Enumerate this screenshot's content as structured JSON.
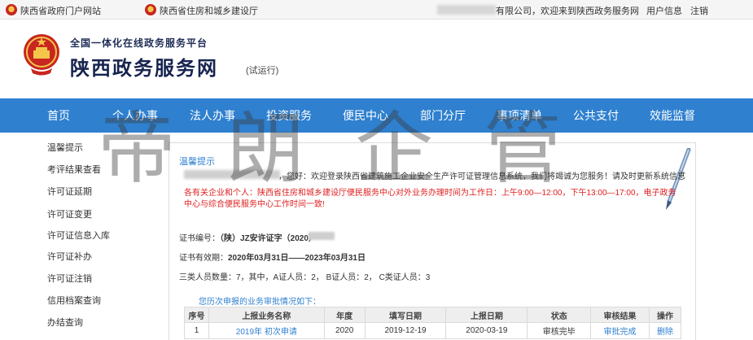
{
  "topbar": {
    "gov_portal": "陕西省政府门户网站",
    "housing_dept": "陕西省住房和城乡建设厅",
    "welcome": "有限公司，欢迎来到陕西政务服务网",
    "user_info": "用户信息",
    "logout": "注销"
  },
  "header": {
    "slogan": "全国一体化在线政务服务平台",
    "site_name": "陕西政务服务网",
    "trial": "(试运行)"
  },
  "nav": [
    "首页",
    "个人办事",
    "法人办事",
    "投资服务",
    "便民中心",
    "部门分厅",
    "事项清单",
    "公共支付",
    "效能监督"
  ],
  "watermark": "帝朗企管",
  "sidebar": [
    "温馨提示",
    "考评结果查看",
    "许可证延期",
    "许可证变更",
    "许可证信息入库",
    "许可证补办",
    "许可证注销",
    "信用档案查询",
    "办结查询"
  ],
  "panel": {
    "title": "温馨提示",
    "welcome": "，您好：欢迎登录陕西省建筑施工企业安全生产许可证管理信息系统，我们将竭诚为您服务！请及时更新系统信息",
    "notice": "各有关企业和个人：陕西省住房和城乡建设厅便民服务中心对外业务办理时间为工作日：上午9:00—12:00，下午13:00—17:00，电子政务中心与综合便民服务中心工作时间一致!",
    "cert_label": "证书编号：",
    "cert_value": "（陕）JZ安许证字（2020）",
    "valid_label": "证书有效期：",
    "valid_value": "2020年03月31日——2023年03月31日",
    "staff": "三类人员数量：7，其中，A证人员：2， B证人员：2， C类证人员：3",
    "history_caption": "您历次申报的业务审批情况如下："
  },
  "table": {
    "headers": [
      "序号",
      "上报业务名称",
      "年度",
      "填写日期",
      "上报日期",
      "状态",
      "审核结果",
      "操作"
    ],
    "rows": [
      [
        "1",
        "2019年 初次申请",
        "2020",
        "2019-12-19",
        "2020-03-19",
        "审核完毕",
        "审批完成",
        "删除"
      ]
    ]
  },
  "colors": {
    "nav_bg": "#2f80cf",
    "link": "#2f7fd0",
    "notice": "#e02020"
  }
}
